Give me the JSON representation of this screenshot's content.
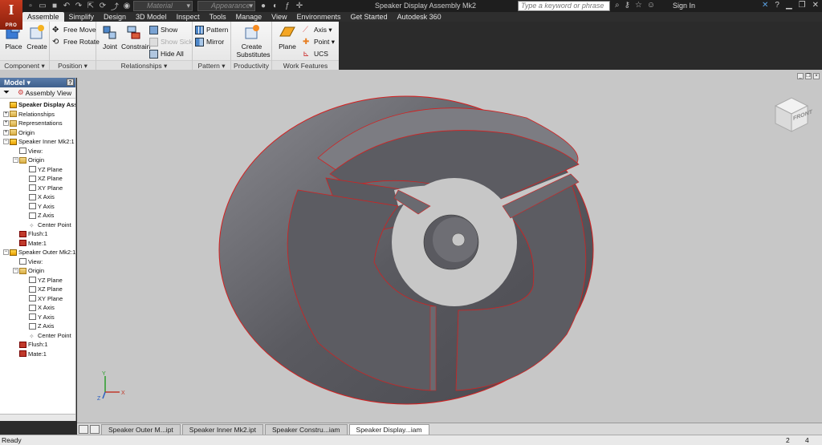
{
  "app": {
    "logo_letter": "I",
    "logo_badge": "PRO",
    "window_title": "Speaker Display Assembly Mk2",
    "material_placeholder": "Material",
    "appearance_placeholder": "Appearance",
    "search_placeholder": "Type a keyword or phrase",
    "sign_in": "Sign In"
  },
  "ribbon_tabs": [
    "Assemble",
    "Simplify",
    "Design",
    "3D Model",
    "Inspect",
    "Tools",
    "Manage",
    "View",
    "Environments",
    "Get Started",
    "Autodesk 360"
  ],
  "ribbon": {
    "component": {
      "label": "Component ▾",
      "place": "Place",
      "create": "Create"
    },
    "position": {
      "label": "Position ▾",
      "free_move": "Free Move",
      "free_rotate": "Free Rotate"
    },
    "relationships": {
      "label": "Relationships ▾",
      "joint": "Joint",
      "constrain": "Constrain",
      "show": "Show",
      "show_sick": "Show Sick",
      "hide_all": "Hide All"
    },
    "pattern": {
      "label": "Pattern ▾",
      "pattern": "Pattern",
      "mirror": "Mirror"
    },
    "productivity": {
      "label": "Productivity",
      "create_substitutes": "Create Substitutes"
    },
    "work_features": {
      "label": "Work Features",
      "plane": "Plane",
      "axis": "Axis ▾",
      "point": "Point ▾",
      "ucs": "UCS"
    }
  },
  "browser": {
    "title": "Model ▾",
    "help": "?",
    "view_label": "Assembly View",
    "tree": [
      {
        "label": "Speaker Display Asse",
        "indent": 0,
        "icon": "part",
        "bold": true,
        "exp": ""
      },
      {
        "label": "Relationships",
        "indent": 0,
        "icon": "folder",
        "exp": "+"
      },
      {
        "label": "Representations",
        "indent": 0,
        "icon": "folder",
        "exp": "+"
      },
      {
        "label": "Origin",
        "indent": 0,
        "icon": "folder",
        "exp": "+"
      },
      {
        "label": "Speaker Inner Mk2:1",
        "indent": 0,
        "icon": "part",
        "exp": "−"
      },
      {
        "label": "View:",
        "indent": 1,
        "icon": "axis",
        "exp": ""
      },
      {
        "label": "Origin",
        "indent": 1,
        "icon": "folder",
        "exp": "−"
      },
      {
        "label": "YZ Plane",
        "indent": 2,
        "icon": "plane",
        "exp": ""
      },
      {
        "label": "XZ Plane",
        "indent": 2,
        "icon": "plane",
        "exp": ""
      },
      {
        "label": "XY Plane",
        "indent": 2,
        "icon": "plane",
        "exp": ""
      },
      {
        "label": "X Axis",
        "indent": 2,
        "icon": "axis",
        "exp": ""
      },
      {
        "label": "Y Axis",
        "indent": 2,
        "icon": "axis",
        "exp": ""
      },
      {
        "label": "Z Axis",
        "indent": 2,
        "icon": "axis",
        "exp": ""
      },
      {
        "label": "Center Point",
        "indent": 2,
        "icon": "point",
        "exp": ""
      },
      {
        "label": "Flush:1",
        "indent": 1,
        "icon": "constraint",
        "exp": ""
      },
      {
        "label": "Mate:1",
        "indent": 1,
        "icon": "constraint",
        "exp": ""
      },
      {
        "label": "Speaker Outer Mk2:1",
        "indent": 0,
        "icon": "part",
        "exp": "−"
      },
      {
        "label": "View:",
        "indent": 1,
        "icon": "axis",
        "exp": ""
      },
      {
        "label": "Origin",
        "indent": 1,
        "icon": "folder",
        "exp": "−"
      },
      {
        "label": "YZ Plane",
        "indent": 2,
        "icon": "plane",
        "exp": ""
      },
      {
        "label": "XZ Plane",
        "indent": 2,
        "icon": "plane",
        "exp": ""
      },
      {
        "label": "XY Plane",
        "indent": 2,
        "icon": "plane",
        "exp": ""
      },
      {
        "label": "X Axis",
        "indent": 2,
        "icon": "axis",
        "exp": ""
      },
      {
        "label": "Y Axis",
        "indent": 2,
        "icon": "axis",
        "exp": ""
      },
      {
        "label": "Z Axis",
        "indent": 2,
        "icon": "axis",
        "exp": ""
      },
      {
        "label": "Center Point",
        "indent": 2,
        "icon": "point",
        "exp": ""
      },
      {
        "label": "Flush:1",
        "indent": 1,
        "icon": "constraint",
        "exp": ""
      },
      {
        "label": "Mate:1",
        "indent": 1,
        "icon": "constraint",
        "exp": ""
      }
    ]
  },
  "viewport": {
    "viewcube_label": "FRONT",
    "axis_x": "X",
    "axis_y": "Y",
    "axis_z": "Z",
    "model_color": "#5e5e64",
    "edge_color": "#d42020",
    "background": "#c7c7c7"
  },
  "document_tabs": [
    {
      "label": "Speaker Outer M...ipt",
      "active": false
    },
    {
      "label": "Speaker Inner Mk2.ipt",
      "active": false
    },
    {
      "label": "Speaker Constru...iam",
      "active": false
    },
    {
      "label": "Speaker Display...iam",
      "active": true
    }
  ],
  "status": {
    "text": "Ready",
    "count_a": "2",
    "count_b": "4"
  }
}
